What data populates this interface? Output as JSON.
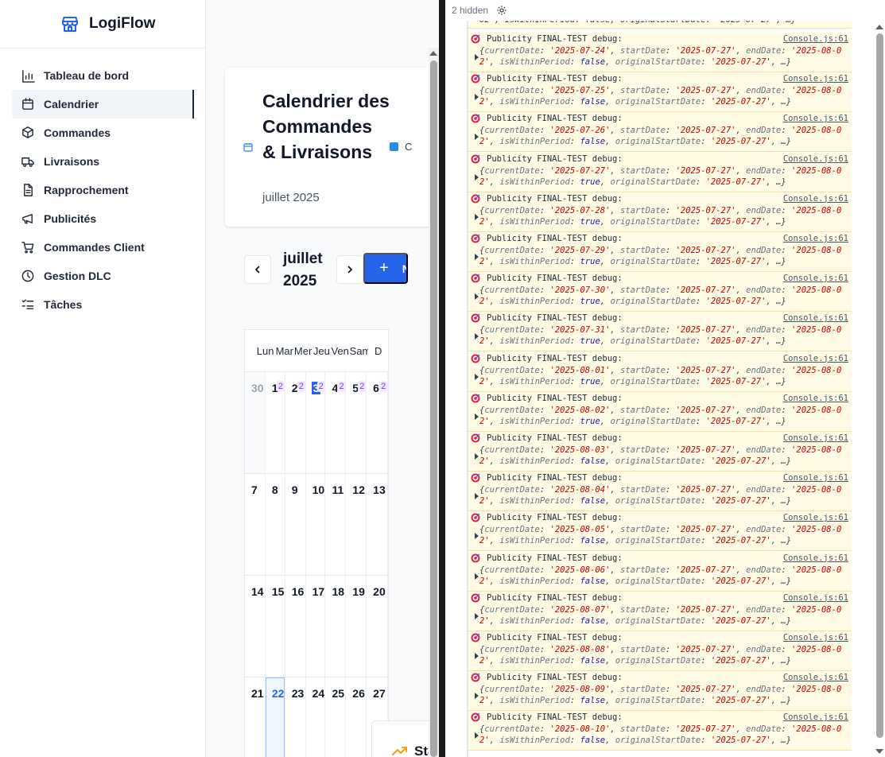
{
  "app": {
    "brand": "LogiFlow",
    "nav": [
      {
        "label": "Tableau de bord",
        "icon": "bar-chart-icon",
        "active": false
      },
      {
        "label": "Calendrier",
        "icon": "calendar-icon",
        "active": true
      },
      {
        "label": "Commandes",
        "icon": "package-icon",
        "active": false
      },
      {
        "label": "Livraisons",
        "icon": "truck-icon",
        "active": false
      },
      {
        "label": "Rapprochement",
        "icon": "file-text-icon",
        "active": false
      },
      {
        "label": "Publicités",
        "icon": "megaphone-icon",
        "active": false
      },
      {
        "label": "Commandes Client",
        "icon": "shopping-cart-icon",
        "active": false
      },
      {
        "label": "Gestion DLC",
        "icon": "clock-icon",
        "active": false
      },
      {
        "label": "Tâches",
        "icon": "list-check-icon",
        "active": false
      }
    ]
  },
  "header": {
    "title": "Calendrier des Commandes & Livraisons",
    "subtitle": "juillet 2025",
    "legend_text": "C"
  },
  "toolbar": {
    "month": "juillet 2025",
    "new_label": "N",
    "accent": "#2563eb"
  },
  "calendar": {
    "days_of_week": [
      "Lun",
      "Mar",
      "Mer",
      "Jeu",
      "Ven",
      "Sam",
      "D"
    ],
    "weeks": [
      [
        {
          "n": "30",
          "outside": true
        },
        {
          "n": "1",
          "badge": "2"
        },
        {
          "n": "2",
          "badge": "2"
        },
        {
          "n": "3",
          "badge": "2",
          "today": true
        },
        {
          "n": "4",
          "badge": "2"
        },
        {
          "n": "5",
          "badge": "2"
        },
        {
          "n": "6",
          "badge": "2"
        }
      ],
      [
        {
          "n": "7"
        },
        {
          "n": "8"
        },
        {
          "n": "9"
        },
        {
          "n": "10"
        },
        {
          "n": "11"
        },
        {
          "n": "12"
        },
        {
          "n": "13"
        }
      ],
      [
        {
          "n": "14"
        },
        {
          "n": "15"
        },
        {
          "n": "16"
        },
        {
          "n": "17"
        },
        {
          "n": "18"
        },
        {
          "n": "19"
        },
        {
          "n": "20"
        }
      ],
      [
        {
          "n": "21"
        },
        {
          "n": "22",
          "selected": true
        },
        {
          "n": "23"
        },
        {
          "n": "24"
        },
        {
          "n": "25"
        },
        {
          "n": "26"
        },
        {
          "n": "27"
        }
      ]
    ]
  },
  "stats": {
    "title": "Statistiques du mois"
  },
  "console": {
    "hidden_label": "2 hidden",
    "top_clip": "02', isWithinPeriod: false, originalStartDate: '2025-07-27', …}",
    "message": "Publicity FINAL-TEST debug:",
    "source": "Console.js:61",
    "start_date": "2025-07-27",
    "end_date_a": "2025-08-",
    "end_date_b": "02",
    "original_start": "2025-07-27",
    "entries": [
      {
        "current": "2025-07-24",
        "within": "false"
      },
      {
        "current": "2025-07-25",
        "within": "false"
      },
      {
        "current": "2025-07-26",
        "within": "false"
      },
      {
        "current": "2025-07-27",
        "within": "true"
      },
      {
        "current": "2025-07-28",
        "within": "true"
      },
      {
        "current": "2025-07-29",
        "within": "true"
      },
      {
        "current": "2025-07-30",
        "within": "true"
      },
      {
        "current": "2025-07-31",
        "within": "true"
      },
      {
        "current": "2025-08-01",
        "within": "true"
      },
      {
        "current": "2025-08-02",
        "within": "true"
      },
      {
        "current": "2025-08-03",
        "within": "false"
      },
      {
        "current": "2025-08-04",
        "within": "false"
      },
      {
        "current": "2025-08-05",
        "within": "false"
      },
      {
        "current": "2025-08-06",
        "within": "false"
      },
      {
        "current": "2025-08-07",
        "within": "false"
      },
      {
        "current": "2025-08-08",
        "within": "false"
      },
      {
        "current": "2025-08-09",
        "within": "false"
      },
      {
        "current": "2025-08-10",
        "within": "false"
      }
    ]
  }
}
